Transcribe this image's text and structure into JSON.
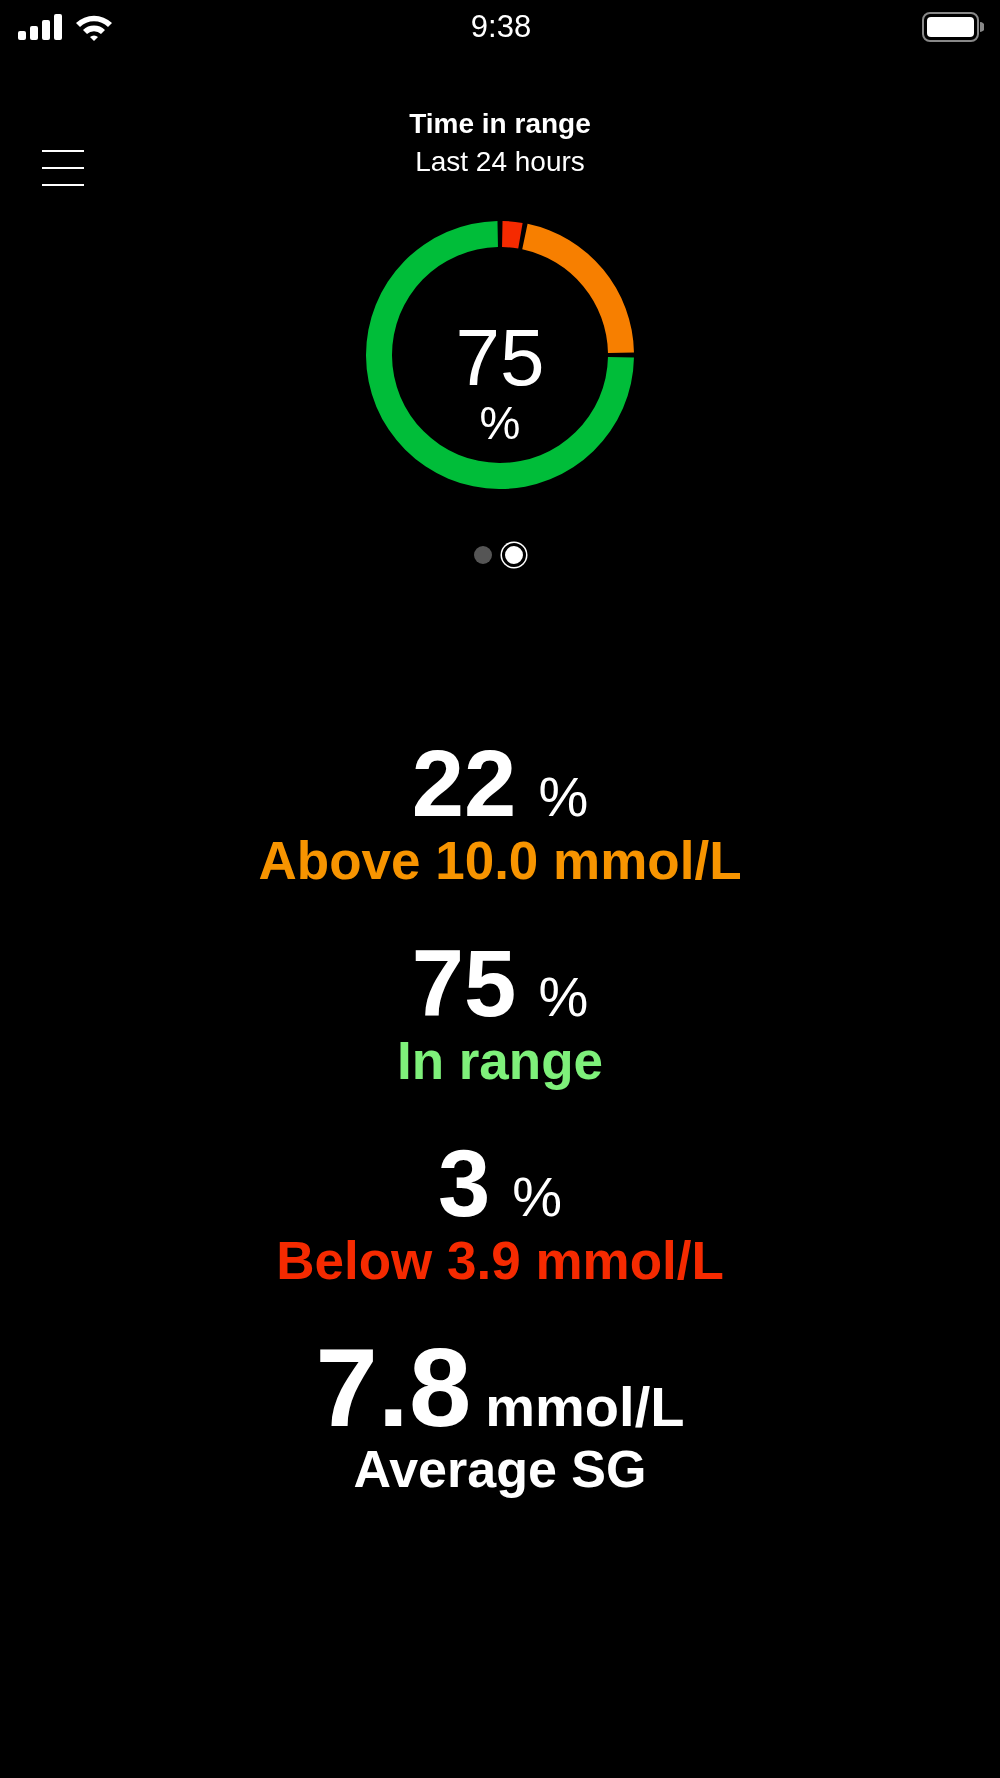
{
  "status_bar": {
    "time": "9:38"
  },
  "header": {
    "title": "Time in range",
    "subtitle": "Last 24 hours"
  },
  "ring": {
    "value": "75",
    "unit": "%",
    "chart_data": {
      "type": "donut",
      "values": [
        3,
        22,
        75
      ],
      "colors": [
        "#f52a00",
        "#f77f00",
        "#00bd39"
      ]
    }
  },
  "pager": [
    {
      "selected": false
    },
    {
      "selected": true
    }
  ],
  "stats": [
    {
      "kind": "percent",
      "value": "22",
      "unit": "%",
      "label": "Above 10.0 mmol/L",
      "color": "#f79400"
    },
    {
      "kind": "percent",
      "value": "75",
      "unit": "%",
      "label": "In range",
      "color": "#7ef07a"
    },
    {
      "kind": "percent",
      "value": "3",
      "unit": "%",
      "label": "Below 3.9 mmol/L",
      "color": "#f52a00"
    },
    {
      "kind": "average",
      "value": "7.8",
      "unit": "mmol/L",
      "label": "Average SG",
      "color": "#ffffff"
    }
  ]
}
